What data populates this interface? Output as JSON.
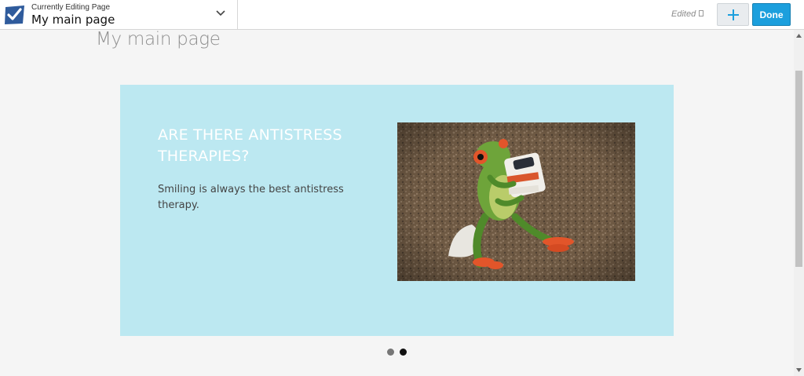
{
  "editor": {
    "caption": "Currently Editing Page",
    "current_page": "My main page",
    "status": "Edited",
    "done_label": "Done"
  },
  "page": {
    "title": "My main page"
  },
  "slider": {
    "heading": "ARE THERE ANTISTRESS THERAPIES?",
    "text": "Smiling is always the best antistress therapy.",
    "active_slide": 2,
    "slide_count": 2,
    "background": "#bce8f1"
  },
  "colors": {
    "accent": "#1c9fdd",
    "icon_blue": "#2f5b9c"
  }
}
